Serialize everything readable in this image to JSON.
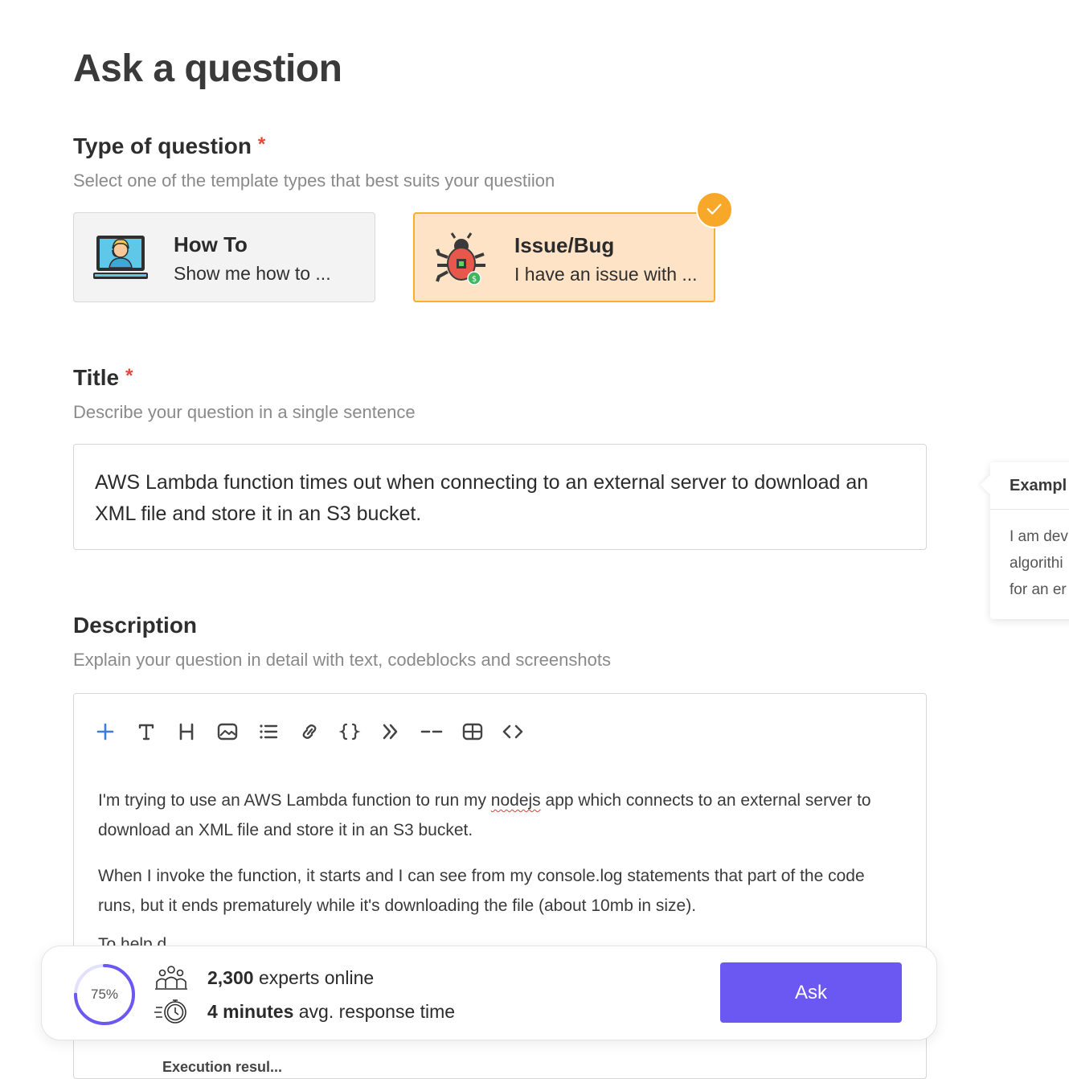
{
  "page": {
    "title": "Ask a question"
  },
  "type_section": {
    "label": "Type of question",
    "required_mark": "*",
    "help": "Select one of the template types that best suits your questiion",
    "options": [
      {
        "title": "How To",
        "subtitle": "Show me how to ...",
        "selected": false
      },
      {
        "title": "Issue/Bug",
        "subtitle": "I have an issue with ...",
        "selected": true
      }
    ],
    "selected_color": "#f7a829"
  },
  "title_section": {
    "label": "Title",
    "required_mark": "*",
    "help": "Describe your question in a single sentence",
    "value": "AWS Lambda function times out when connecting to an external server to download an XML file and store it in an S3 bucket."
  },
  "example_popover": {
    "title": "Exampl",
    "lines": [
      "I am dev",
      "algorithi",
      "for an er"
    ]
  },
  "description_section": {
    "label": "Description",
    "help": "Explain your question in detail with text, codeblocks and screenshots",
    "toolbar": [
      "plus-icon",
      "text-icon",
      "heading-icon",
      "image-icon",
      "list-icon",
      "link-icon",
      "code-braces-icon",
      "quote-icon",
      "divider-icon",
      "table-icon",
      "embed-code-icon"
    ],
    "paragraphs": [
      {
        "before": "I'm trying to use an AWS Lambda function to run my ",
        "misspelled": "nodejs",
        "after": " app which connects to an external server to download an XML file and store it in an S3 bucket."
      },
      {
        "text": "When I invoke the function, it starts and I can see from my console.log statements that part of the code runs, but it ends prematurely while it's downloading the file (about 10mb in size)."
      }
    ],
    "partial_line": "To help d...",
    "partial_caption": "Execution resul..."
  },
  "ask_bar": {
    "progress_label": "75%",
    "progress_value": 0.75,
    "experts_count": "2,300",
    "experts_text": " experts online",
    "response_time": "4 minutes",
    "response_text": " avg. response time",
    "ask_label": "Ask",
    "accent": "#6b57f2"
  }
}
